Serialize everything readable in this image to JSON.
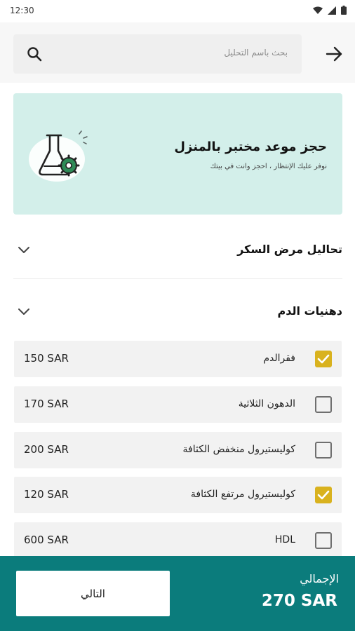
{
  "status_bar": {
    "time": "12:30"
  },
  "search": {
    "placeholder": "بحث باسم التحليل"
  },
  "banner": {
    "title": "حجز موعد مختبر بالمنزل",
    "subtitle": "نوفر عليك الإنتظار ، احجز وانت في بيتك",
    "illustration_icon": "lab-flask-icon"
  },
  "sections": [
    {
      "title": "تحاليل مرض السكر",
      "expanded": false
    },
    {
      "title": "دهنيات الدم",
      "expanded": true
    }
  ],
  "tests": [
    {
      "name": "فقرالدم",
      "price": "150 SAR",
      "checked": true
    },
    {
      "name": "الدهون الثلاثية",
      "price": "170 SAR",
      "checked": false
    },
    {
      "name": "كوليستيرول منخفض الكثافة",
      "price": "200 SAR",
      "checked": false
    },
    {
      "name": "كوليستيرول مرتفع الكثافة",
      "price": "120 SAR",
      "checked": true
    },
    {
      "name": "HDL",
      "price": "600 SAR",
      "checked": false
    }
  ],
  "footer": {
    "total_label": "الإجمالي",
    "total_value": "270 SAR",
    "next_label": "التالي"
  },
  "colors": {
    "accent": "#0b7c7c",
    "checkbox_checked": "#d9b21e",
    "banner_bg": "#d3efea"
  }
}
